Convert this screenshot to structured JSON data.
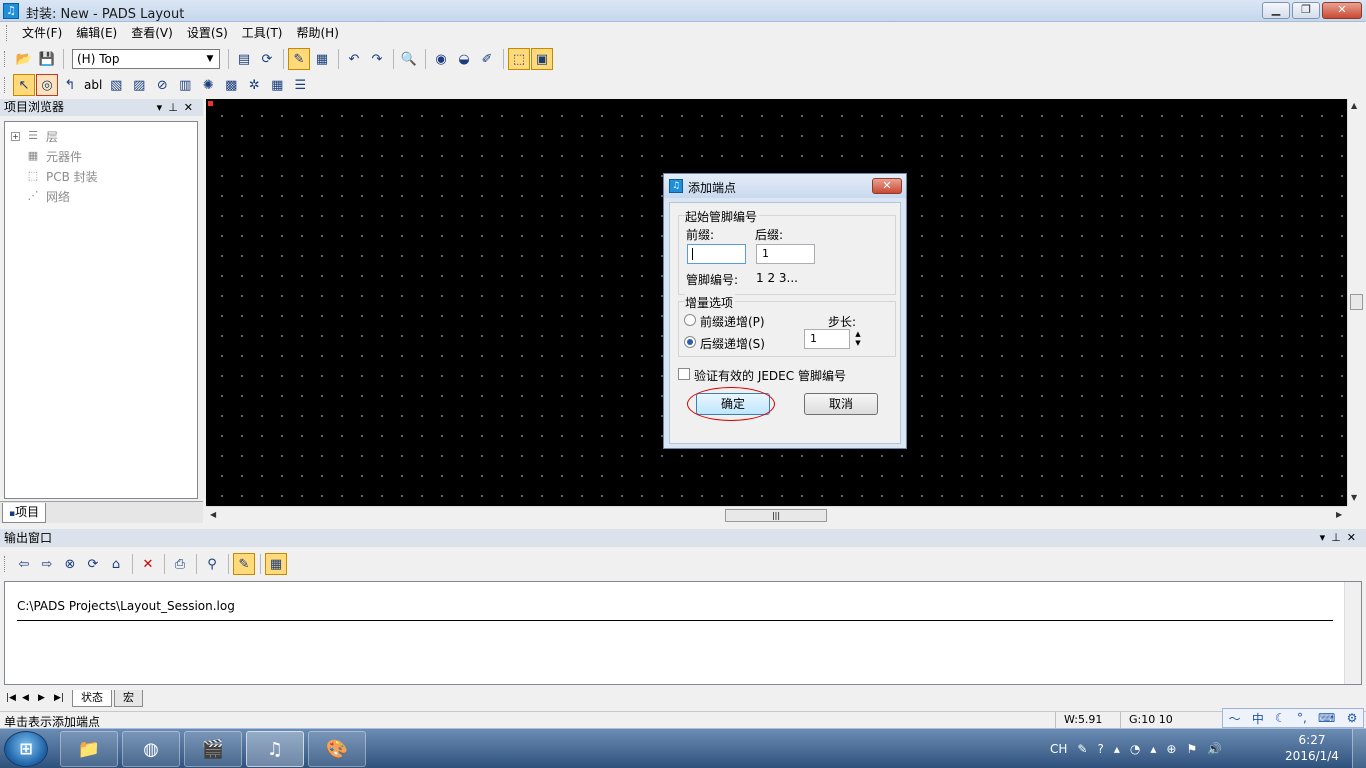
{
  "window": {
    "title": "封装: New - PADS Layout",
    "icon": "pads-logo-icon"
  },
  "menu": [
    "文件(F)",
    "编辑(E)",
    "查看(V)",
    "设置(S)",
    "工具(T)",
    "帮助(H)"
  ],
  "toolbar": {
    "layer_select_value": "(H) Top",
    "text_tool_label": "abl"
  },
  "project_browser": {
    "title": "项目浏览器",
    "tree": [
      {
        "label": "层",
        "expandable": true
      },
      {
        "label": "元器件",
        "expandable": false
      },
      {
        "label": "PCB 封装",
        "expandable": false
      },
      {
        "label": "网络",
        "expandable": false
      }
    ],
    "tab_label": "项目"
  },
  "dialog": {
    "title": "添加端点",
    "close_label": "✕",
    "start_group_title": "起始管脚编号",
    "prefix_label": "前缀:",
    "prefix_value": "",
    "suffix_label": "后缀:",
    "suffix_value": "1",
    "pin_number_label": "管脚编号:",
    "pin_number_value": "1 2 3...",
    "increment_group_title": "增量选项",
    "prefix_increment_label": "前缀递增(P)",
    "suffix_increment_label": "后缀递增(S)",
    "selected_increment": "suffix",
    "step_label": "步长:",
    "step_value": "1",
    "jedec_label": "验证有效的 JEDEC 管脚编号",
    "jedec_checked": false,
    "ok_label": "确定",
    "cancel_label": "取消"
  },
  "output_window": {
    "title": "输出窗口",
    "log_path": "C:\\PADS Projects\\Layout_Session.log",
    "tabs": [
      "状态",
      "宏"
    ]
  },
  "status_bar": {
    "message": "单击表示添加端点",
    "width": "W:5.91",
    "grid": "G:10 10"
  },
  "taskbar": {
    "lang": "CH",
    "time": "6:27",
    "date": "2016/1/4"
  },
  "colors": {
    "canvas_bg": "#000000",
    "grid_dot": "#7a7a7a",
    "highlight_ring": "#dd0000"
  }
}
